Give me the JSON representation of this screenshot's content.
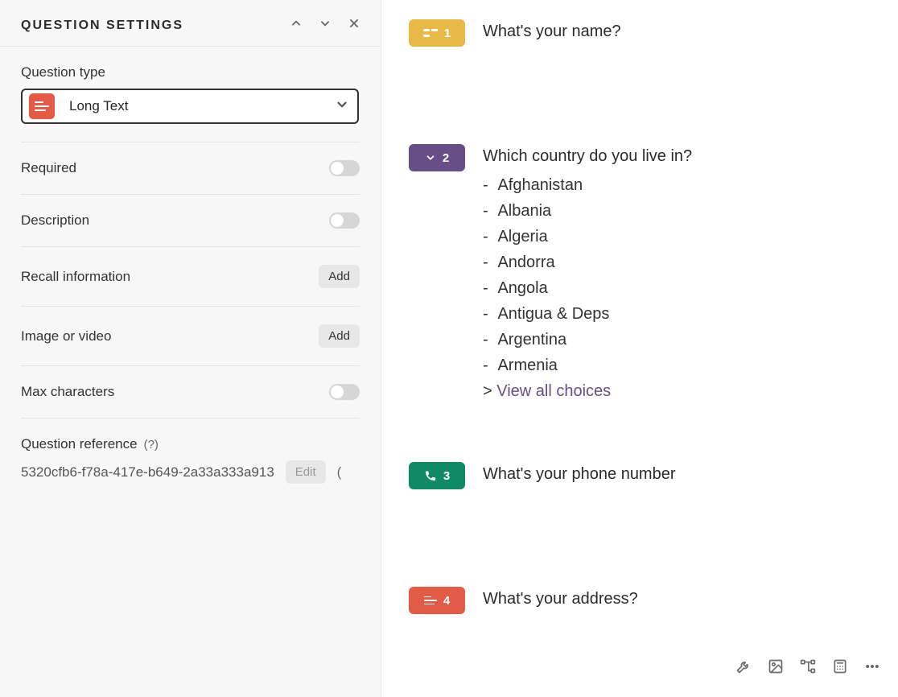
{
  "panel": {
    "title": "QUESTION SETTINGS",
    "question_type": {
      "label": "Question type",
      "selected": "Long Text",
      "icon": "lines-icon",
      "icon_bg": "#e15b46"
    },
    "settings": {
      "required": {
        "label": "Required",
        "type": "toggle",
        "on": false
      },
      "description": {
        "label": "Description",
        "type": "toggle",
        "on": false
      },
      "recall": {
        "label": "Recall information",
        "type": "button",
        "action_label": "Add"
      },
      "media": {
        "label": "Image or video",
        "type": "button",
        "action_label": "Add"
      },
      "max_chars": {
        "label": "Max characters",
        "type": "toggle",
        "on": false
      }
    },
    "reference": {
      "label": "Question reference",
      "help": "(?)",
      "value": "5320cfb6-f78a-417e-b649-2a33a333a913",
      "edit_label": "Edit",
      "tail": "("
    },
    "controls": {
      "up": "⌃",
      "down": "⌄",
      "close": "✕"
    }
  },
  "questions": [
    {
      "badge_variant": "amber",
      "icon": "short-text-icon",
      "number": "1",
      "title": "What's your name?"
    },
    {
      "badge_variant": "purple",
      "icon": "dropdown-icon",
      "number": "2",
      "title": "Which country do you live in?",
      "choices": [
        "Afghanistan",
        "Albania",
        "Algeria",
        "Andorra",
        "Angola",
        "Antigua & Deps",
        "Argentina",
        "Armenia"
      ],
      "view_all_prefix": "> ",
      "view_all_label": "View all choices"
    },
    {
      "badge_variant": "green",
      "icon": "phone-icon",
      "number": "3",
      "title": "What's your phone number"
    },
    {
      "badge_variant": "red",
      "icon": "long-text-icon",
      "number": "4",
      "title": "What's your address?"
    }
  ],
  "toolbar": {
    "items": [
      "wrench-icon",
      "image-icon",
      "branch-icon",
      "calculator-icon",
      "more-icon"
    ]
  }
}
